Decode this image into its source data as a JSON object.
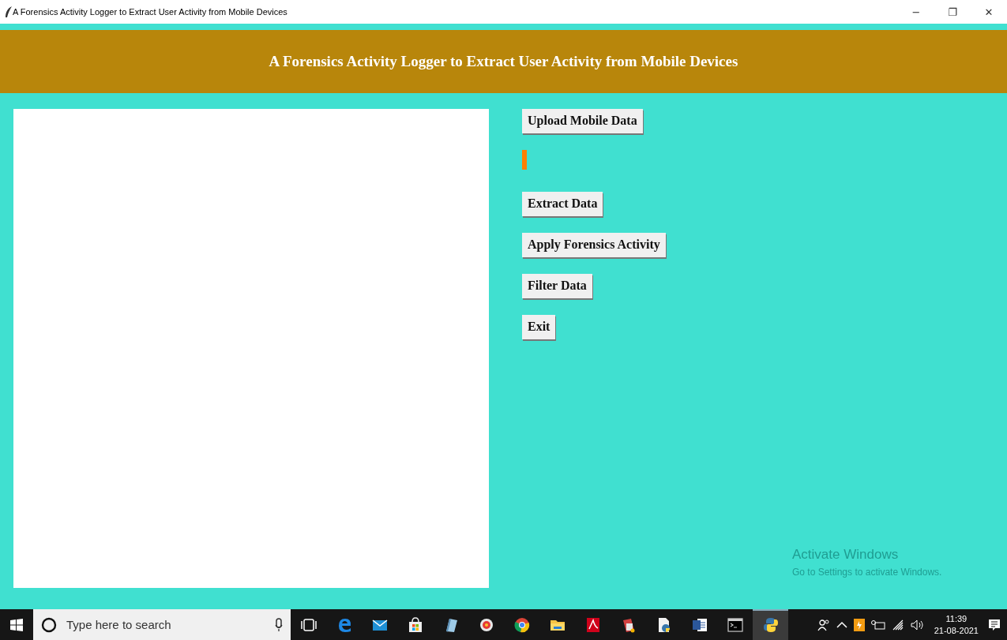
{
  "window": {
    "title": "A Forensics Activity Logger to Extract User Activity from Mobile Devices",
    "controls": [
      "−",
      "❐",
      "✕"
    ]
  },
  "header": {
    "title": "A Forensics Activity Logger to Extract User Activity from Mobile Devices"
  },
  "buttons": [
    {
      "kind": "button",
      "label": "Upload Mobile Data"
    },
    {
      "kind": "marker"
    },
    {
      "kind": "button",
      "label": "Extract Data"
    },
    {
      "kind": "button",
      "label": "Apply Forensics Activity"
    },
    {
      "kind": "button",
      "label": "Filter Data"
    },
    {
      "kind": "button",
      "label": "Exit"
    }
  ],
  "activation_notice": {
    "title": "Activate Windows",
    "message": "Go to Settings to activate Windows."
  },
  "taskbar": {
    "search": {
      "placeholder": "Type here to search"
    },
    "apps": [
      {
        "selected": false
      },
      {
        "selected": false
      },
      {
        "selected": false
      },
      {
        "selected": false
      },
      {
        "selected": false
      },
      {
        "selected": false
      },
      {
        "selected": false
      },
      {
        "selected": false
      },
      {
        "selected": false
      },
      {
        "selected": false
      },
      {
        "selected": false
      },
      {
        "selected": false
      },
      {
        "selected": false
      },
      {
        "selected": true
      }
    ],
    "clock": {
      "time": "11:39",
      "date": "21-08-2021"
    }
  }
}
